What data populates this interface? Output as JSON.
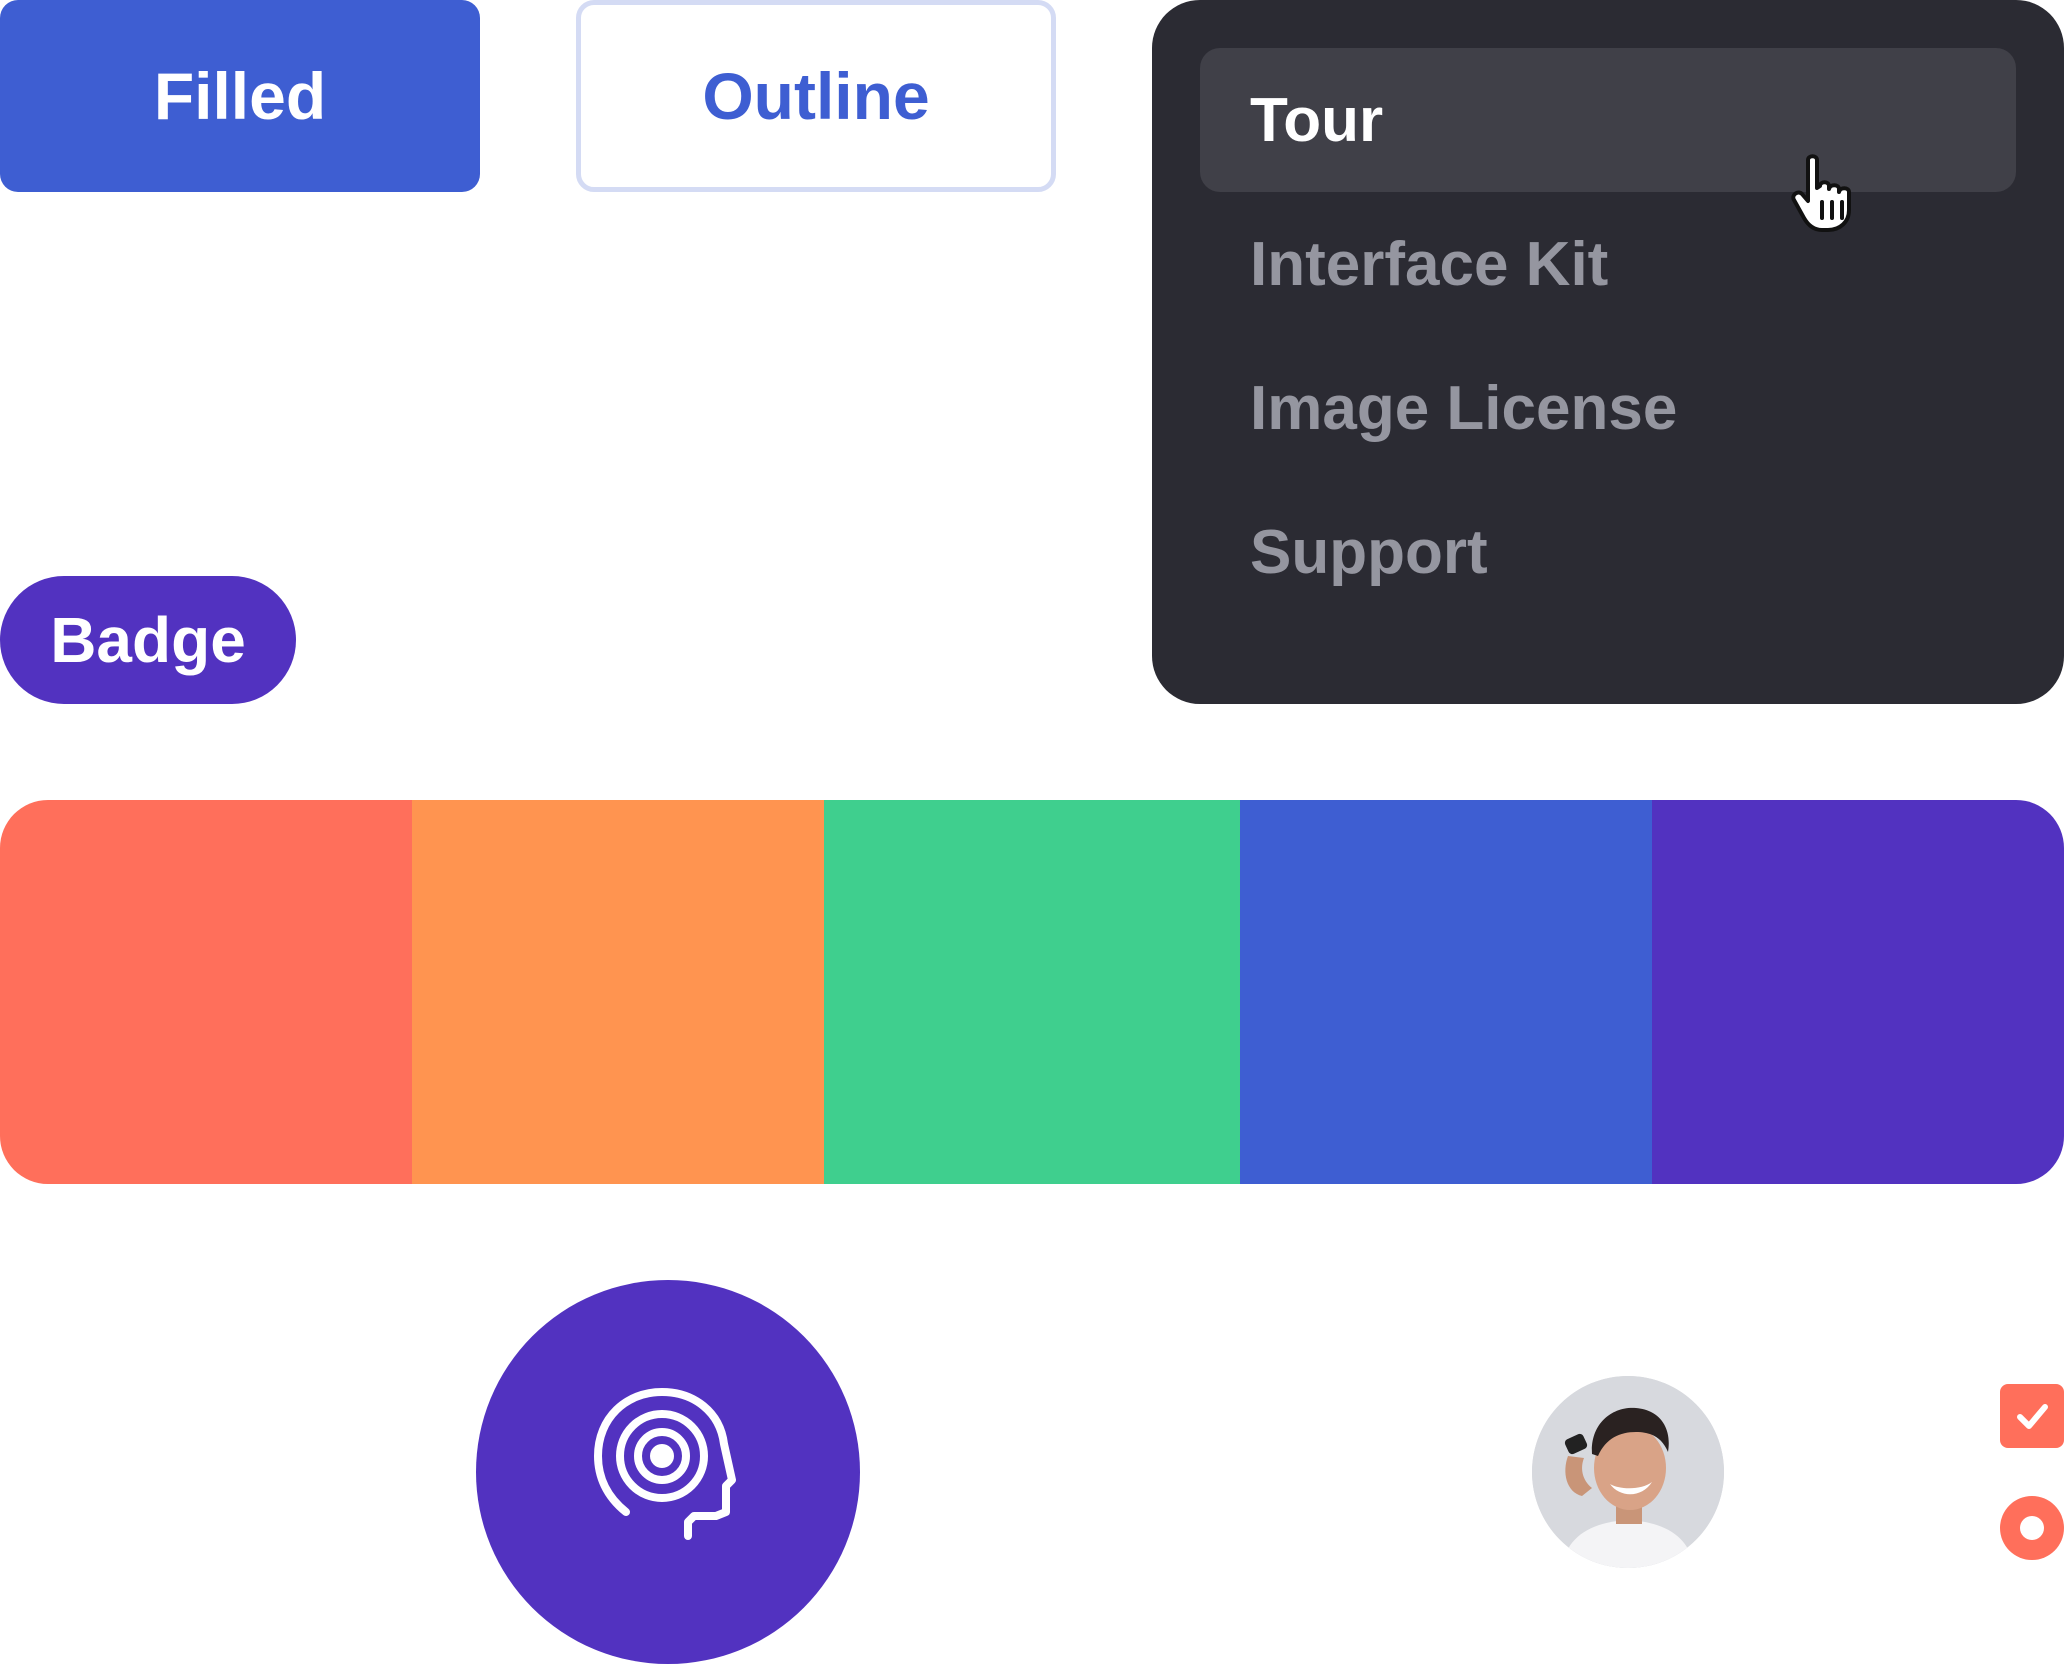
{
  "buttons": {
    "filled_label": "Filled",
    "outline_label": "Outline"
  },
  "badge": {
    "label": "Badge"
  },
  "menu": {
    "items": [
      {
        "label": "Tour",
        "active": true
      },
      {
        "label": "Interface Kit",
        "active": false
      },
      {
        "label": "Image License",
        "active": false
      },
      {
        "label": "Support",
        "active": false
      }
    ]
  },
  "palette": {
    "colors": [
      "#ff6f5b",
      "#ff9450",
      "#3fcf8e",
      "#3e5ed2",
      "#5232c0"
    ]
  },
  "icons": {
    "feature_icon": "head-target-icon",
    "cursor": "hand-pointer-icon",
    "checkbox_mark": "check-icon"
  },
  "controls": {
    "checkbox_checked": true,
    "radio_selected": true
  },
  "theme": {
    "primary": "#3e5ed2",
    "accent": "#5232c0",
    "menu_bg": "#2b2b33",
    "menu_active_bg": "#404048",
    "menu_muted_text": "#9596a0",
    "control_color": "#ff6f5b"
  }
}
